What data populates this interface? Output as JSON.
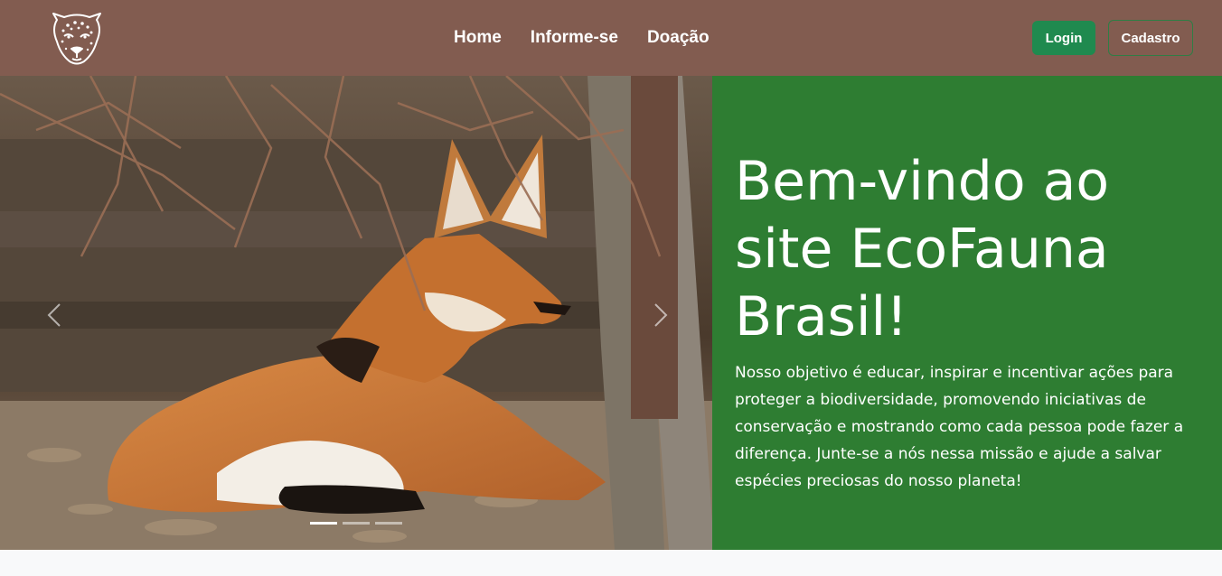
{
  "colors": {
    "nav_bg": "#825c50",
    "hero_bg": "#2e7d32",
    "login_bg": "#1f8a4f",
    "cadastro_border": "#2f7d45"
  },
  "header": {
    "logo_icon": "jaguar-head-icon",
    "nav": [
      {
        "label": "Home"
      },
      {
        "label": "Informe-se"
      },
      {
        "label": "Doação"
      }
    ],
    "login_label": "Login",
    "cadastro_label": "Cadastro"
  },
  "carousel": {
    "image": "maned-wolf-photo",
    "prev_icon": "chevron-left-icon",
    "next_icon": "chevron-right-icon",
    "slide_count": 3,
    "active_slide": 1
  },
  "hero": {
    "title": "Bem-vindo ao site EcoFauna Brasil!",
    "text": "Nosso objetivo é educar, inspirar e incentivar ações para proteger a biodiversidade, promovendo iniciativas de conservação e mostrando como cada pessoa pode fazer a diferença. Junte-se a nós nessa missão e ajude a salvar espécies preciosas do nosso planeta!"
  }
}
